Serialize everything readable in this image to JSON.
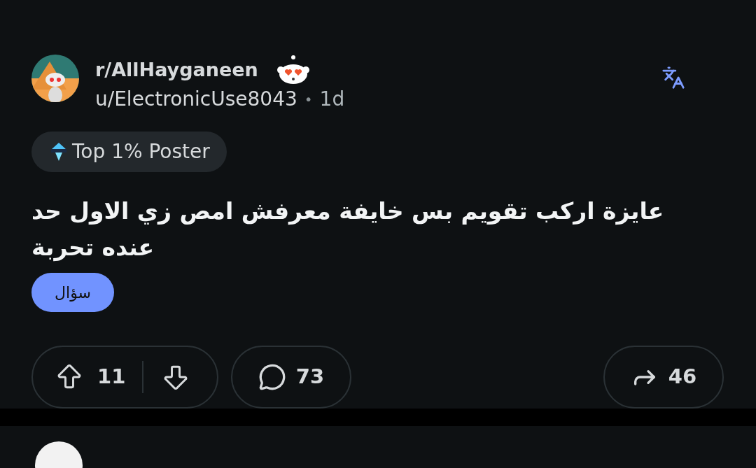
{
  "post": {
    "subreddit": "r/AllHayganeen",
    "author": "u/ElectronicUse8043",
    "separator": "•",
    "age": "1d",
    "badge": "Top 1% Poster",
    "title": "عايزة اركب تقويم بس خايفة معرفش امص زي الاول حد عنده تحربة",
    "flair": "سؤال",
    "votes": "11",
    "comments": "73",
    "shares": "46"
  }
}
